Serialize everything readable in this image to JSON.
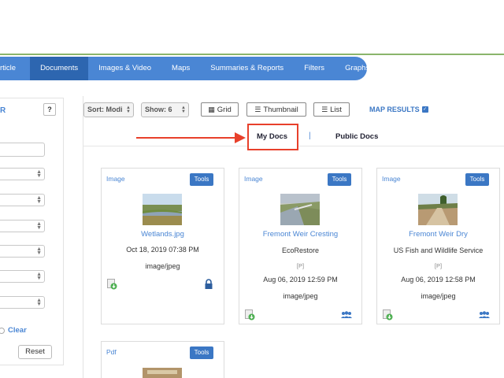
{
  "nav": {
    "items": [
      {
        "label": "rticle",
        "active": false
      },
      {
        "label": "Documents",
        "active": true
      },
      {
        "label": "Images & Video",
        "active": false
      },
      {
        "label": "Maps",
        "active": false
      },
      {
        "label": "Summaries & Reports",
        "active": false
      },
      {
        "label": "Filters",
        "active": false
      },
      {
        "label": "Graphs",
        "active": false
      }
    ]
  },
  "sidebar": {
    "heading": "R",
    "help_label": "?",
    "clear_label": "Clear",
    "reset_label": "Reset"
  },
  "toolbar": {
    "sort_label": "Sort: Modi",
    "show_label": "Show: 6",
    "grid_label": "Grid",
    "thumbnail_label": "Thumbnail",
    "list_label": "List",
    "map_results_label": "MAP RESULTS"
  },
  "tabs": {
    "my_docs": "My Docs",
    "separator": "|",
    "public_docs": "Public Docs"
  },
  "cards": [
    {
      "type": "Image",
      "tools": "Tools",
      "title": "Wetlands.jpg",
      "line1": "Oct 18, 2019 07:38 PM",
      "line2": "image/jpeg",
      "icon": "lock-icon"
    },
    {
      "type": "Image",
      "tools": "Tools",
      "title": "Fremont Weir Cresting",
      "line1": "EcoRestore",
      "line2": "[P]",
      "line3": "Aug 06, 2019 12:59 PM",
      "line4": "image/jpeg",
      "icon": "group-icon"
    },
    {
      "type": "Image",
      "tools": "Tools",
      "title": "Fremont Weir Dry",
      "line1": "US Fish and Wildlife Service",
      "line2": "[P]",
      "line3": "Aug 06, 2019 12:58 PM",
      "line4": "image/jpeg",
      "icon": "group-icon"
    },
    {
      "type": "Pdf",
      "tools": "Tools"
    }
  ],
  "colors": {
    "nav_bg": "#4a86d4",
    "nav_active": "#2d66b0",
    "accent": "#3b77c4",
    "highlight": "#e8402b"
  }
}
